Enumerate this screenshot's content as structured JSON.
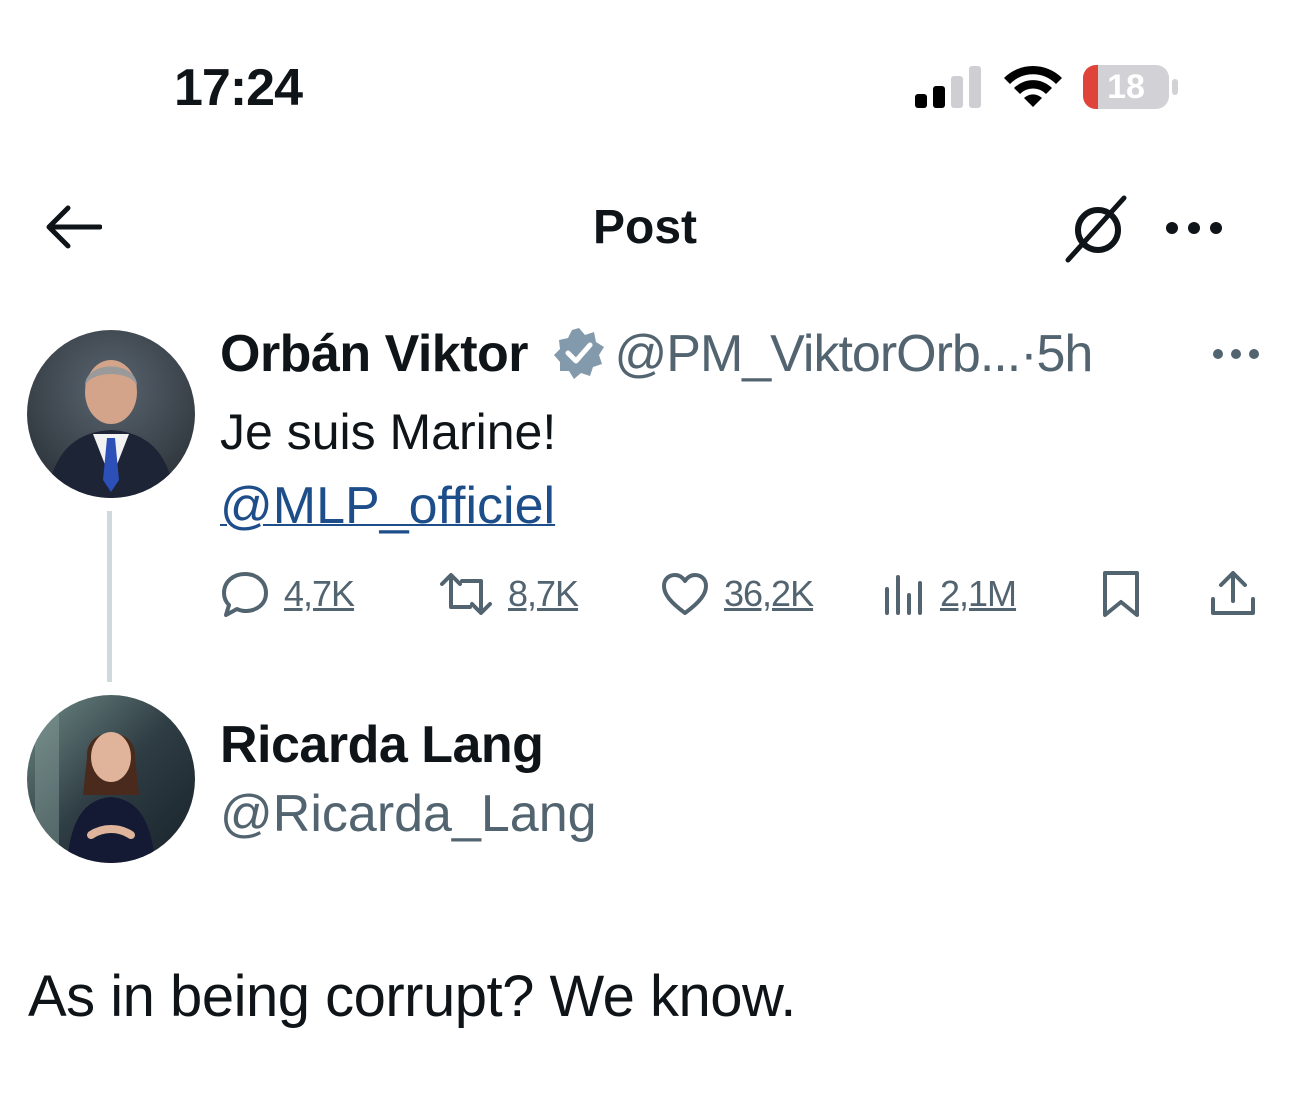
{
  "status_bar": {
    "time": "17:24",
    "battery_level": "18",
    "signal_bars_active": 2,
    "signal_bars_total": 4,
    "icons": [
      "cellular-signal-icon",
      "wifi-icon",
      "battery-icon"
    ],
    "battery_color": "#e0433a"
  },
  "header": {
    "title": "Post",
    "icons": [
      "back-arrow-icon",
      "grok-icon",
      "more-horizontal-icon"
    ]
  },
  "post": {
    "author_name": "Orbán Viktor",
    "verified": true,
    "verified_color": "#829aab",
    "handle": "@PM_ViktorOrb...",
    "separator": "·",
    "time": "5h",
    "text": "Je suis Marine!",
    "mention": "@MLP_officiel",
    "mention_color": "#1d4e89",
    "actions": {
      "replies": "4,7K",
      "reposts": "8,7K",
      "likes": "36,2K",
      "views": "2,1M"
    },
    "action_icons": [
      "reply-icon",
      "repost-icon",
      "like-icon",
      "views-icon",
      "bookmark-icon",
      "share-icon"
    ]
  },
  "reply": {
    "author_name": "Ricarda Lang",
    "handle": "@Ricarda_Lang",
    "text": "As in being corrupt? We know."
  },
  "colors": {
    "text_primary": "#0f1419",
    "text_secondary": "#536471",
    "thread_line": "#cfd9de"
  }
}
